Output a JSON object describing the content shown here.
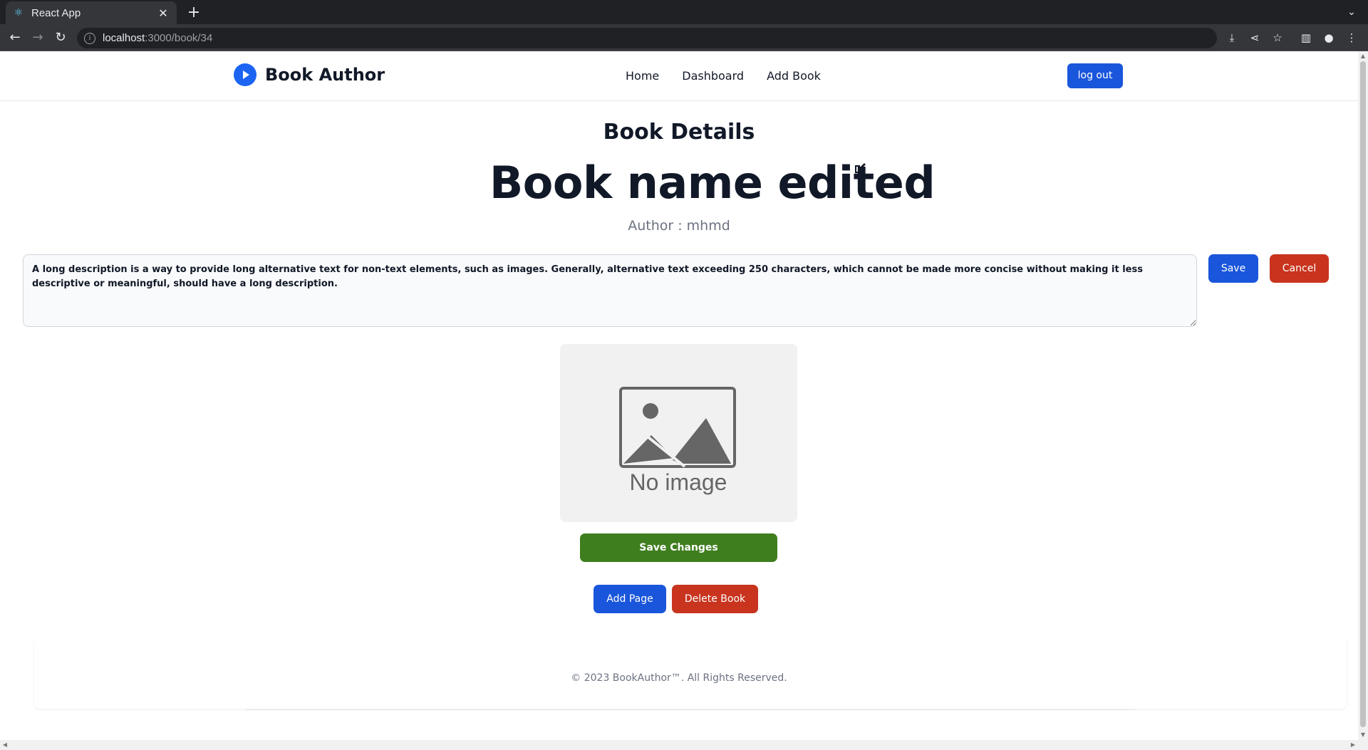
{
  "browser": {
    "tab_title": "React App",
    "tab_favicon": "react-icon",
    "url_host": "localhost",
    "url_path": ":3000/book/34"
  },
  "navbar": {
    "brand": "Book Author",
    "links": [
      "Home",
      "Dashboard",
      "Add Book"
    ],
    "logout_label": "log out"
  },
  "main": {
    "heading": "Book Details",
    "book_title": "Book name edited",
    "author_label": "Author : mhmd",
    "description": "A long description is a way to provide long alternative text for non-text elements, such as images. Generally, alternative text exceeding 250 characters, which cannot be made more concise without making it less descriptive or meaningful, should have a long description.",
    "save_label": "Save",
    "cancel_label": "Cancel",
    "image_placeholder_text": "No image",
    "save_changes_label": "Save Changes",
    "add_page_label": "Add Page",
    "delete_book_label": "Delete Book"
  },
  "footer": {
    "text": "© 2023 BookAuthor™. All Rights Reserved."
  },
  "colors": {
    "primary": "#1a56db",
    "danger": "#c8341e",
    "success": "#3f7e1e",
    "text": "#111827",
    "muted": "#6b7280"
  }
}
